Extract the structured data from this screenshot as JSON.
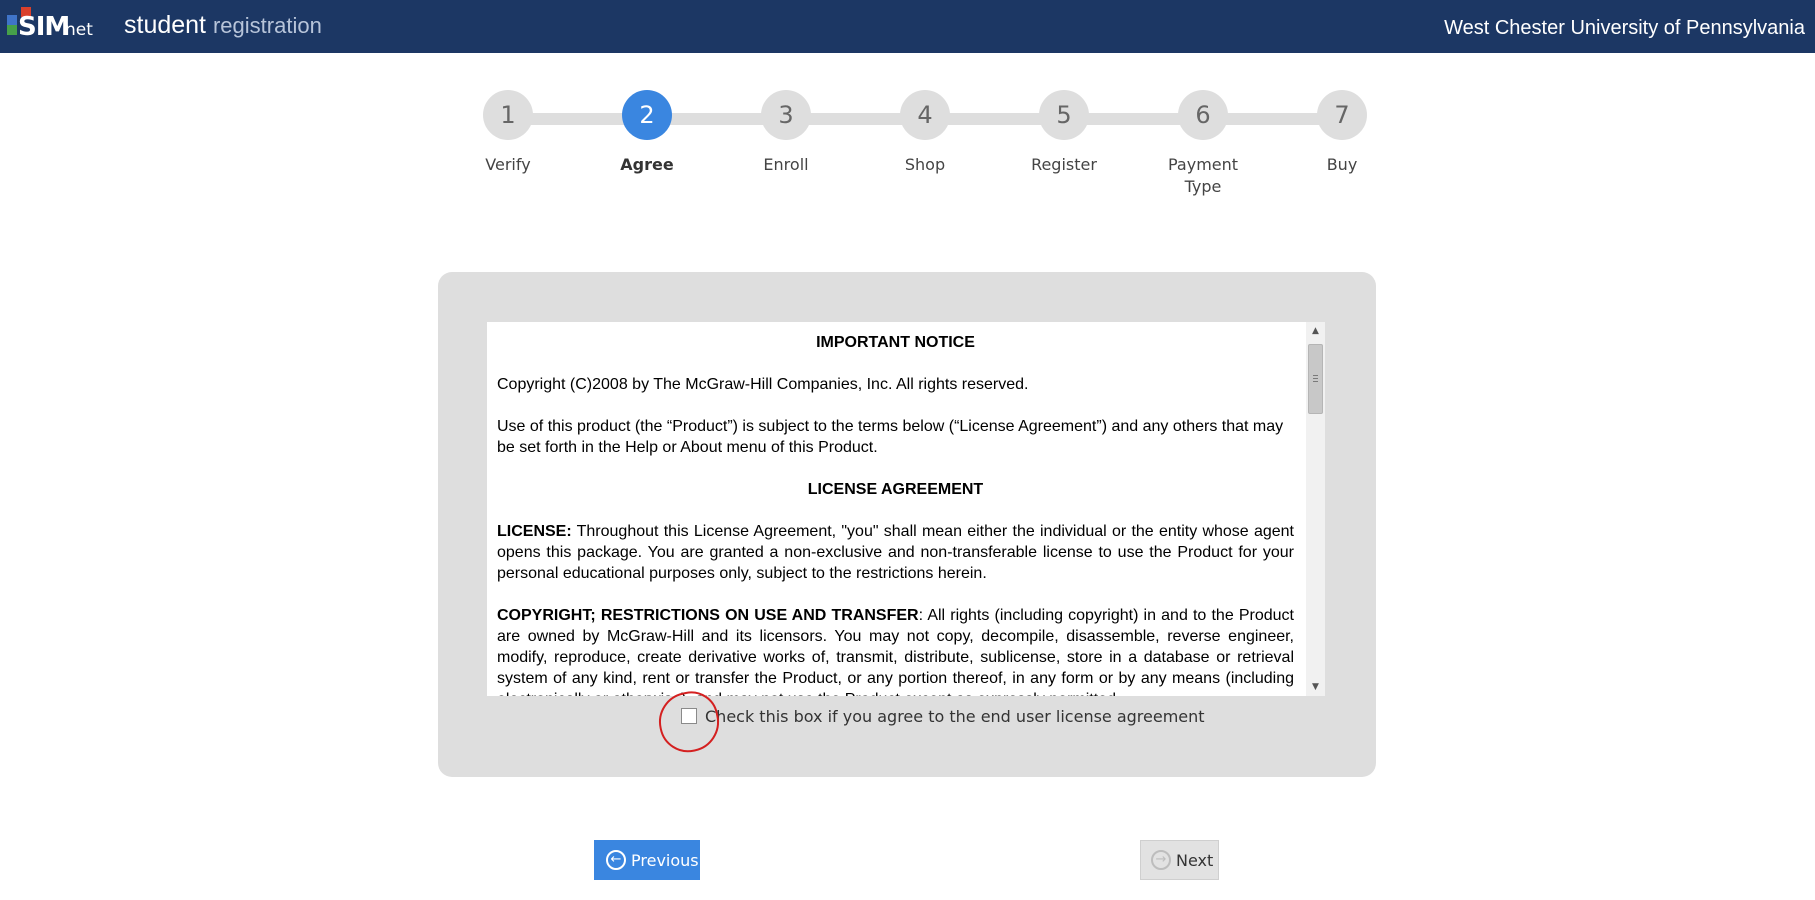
{
  "header": {
    "logo_sim": "SIM",
    "logo_net": "net",
    "title_primary": "student",
    "title_secondary": "registration",
    "university": "West Chester University of Pennsylvania"
  },
  "steps": [
    {
      "number": "1",
      "label": "Verify",
      "active": false
    },
    {
      "number": "2",
      "label": "Agree",
      "active": true
    },
    {
      "number": "3",
      "label": "Enroll",
      "active": false
    },
    {
      "number": "4",
      "label": "Shop",
      "active": false
    },
    {
      "number": "5",
      "label": "Register",
      "active": false
    },
    {
      "number": "6",
      "label": "Payment Type",
      "active": false
    },
    {
      "number": "7",
      "label": "Buy",
      "active": false
    }
  ],
  "license": {
    "notice_heading": "IMPORTANT NOTICE",
    "copyright_line": "Copyright (C)2008 by The McGraw-Hill Companies, Inc.  All rights reserved.",
    "use_paragraph": "Use of this product (the “Product”) is subject to the terms below (“License Agreement”) and any others that may be set forth in the Help or About menu of this Product.",
    "agreement_heading": "LICENSE AGREEMENT",
    "license_term": "LICENSE:",
    "license_text": "  Throughout this License Agreement, \"you\" shall mean either the individual or the entity whose agent opens this package.  You are granted a non-exclusive and non-transferable license to use the Product for your personal educational purposes only, subject to the restrictions herein.",
    "copyright_term": "COPYRIGHT; RESTRICTIONS ON USE AND TRANSFER",
    "copyright_text": ":  All rights (including copyright) in and to the Product are owned by McGraw-Hill and its licensors.  You may not copy, decompile, disassemble, reverse engineer, modify, reproduce, create derivative works of, transmit, distribute, sublicense, store in a database or retrieval system of any kind, rent or transfer the Product, or any portion thereof, in any form or by any means (including electronically or otherwise), and may not use the Product except as expressly permitted"
  },
  "agree": {
    "label": "Check this box if you agree to the end user license agreement",
    "checked": false
  },
  "buttons": {
    "previous": "Previous",
    "next": "Next"
  },
  "colors": {
    "header_bg": "#1c3764",
    "accent_blue": "#3a86e0",
    "panel_gray": "#dedede",
    "annotation_red": "#d42020"
  }
}
